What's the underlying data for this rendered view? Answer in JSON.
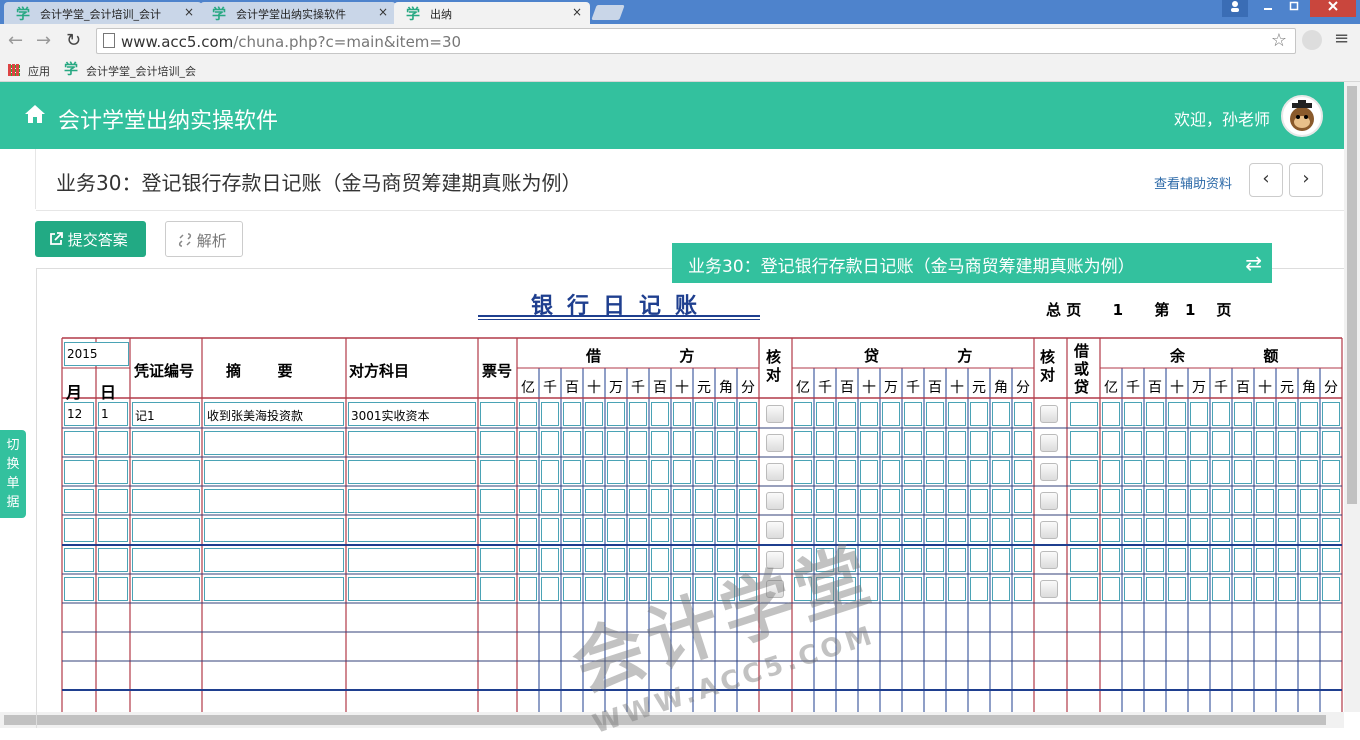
{
  "browser": {
    "tabs": [
      {
        "label": "会计学堂_会计培训_会计",
        "active": false
      },
      {
        "label": "会计学堂出纳实操软件",
        "active": false
      },
      {
        "label": "出纳",
        "active": true
      }
    ],
    "tab_icon_glyph": "学",
    "tab_close_glyph": "×",
    "url_host": "www.acc5.com",
    "url_path": "/chuna.php?c=main&item=30",
    "bookmarks": {
      "apps_label": "应用",
      "item_label": "会计学堂_会计培训_会"
    }
  },
  "app": {
    "title": "会计学堂出纳实操软件",
    "welcome": "欢迎，孙老师",
    "task_title": "业务30：登记银行存款日记账（金马商贸筹建期真账为例）",
    "help_link": "查看辅助资料",
    "prev_glyph": "‹",
    "next_glyph": "›",
    "submit_label": "提交答案",
    "analyze_label": "解析",
    "overlay_title": "业务30：登记银行存款日记账（金马商贸筹建期真账为例）",
    "switch_label": "切换单据",
    "accent_color": "#33c19e"
  },
  "ledger": {
    "title": "银行日记账",
    "total_pages_label": "总 页",
    "total_pages": "1",
    "page_label_pre": "第",
    "page_no": "1",
    "page_label_post": "页",
    "year": "2015",
    "headers": {
      "month": "月",
      "day": "日",
      "voucher": "凭证编号",
      "summary": "摘       要",
      "account": "对方科目",
      "ticket": "票号",
      "debit": "借               方",
      "check": "核对",
      "credit": "贷               方",
      "direction": "借或贷",
      "balance": "余               额"
    },
    "digit_labels": [
      "亿",
      "千",
      "百",
      "十",
      "万",
      "千",
      "百",
      "十",
      "元",
      "角",
      "分"
    ],
    "rows": [
      {
        "month": "12",
        "day": "1",
        "voucher": "记1",
        "summary": "收到张美海投资款",
        "account": "3001实收资本"
      },
      {
        "month": "",
        "day": "",
        "voucher": "",
        "summary": "",
        "account": ""
      },
      {
        "month": "",
        "day": "",
        "voucher": "",
        "summary": "",
        "account": ""
      },
      {
        "month": "",
        "day": "",
        "voucher": "",
        "summary": "",
        "account": ""
      },
      {
        "month": "",
        "day": "",
        "voucher": "",
        "summary": "",
        "account": ""
      },
      {
        "month": "",
        "day": "",
        "voucher": "",
        "summary": "",
        "account": ""
      },
      {
        "month": "",
        "day": "",
        "voucher": "",
        "summary": "",
        "account": ""
      }
    ]
  }
}
